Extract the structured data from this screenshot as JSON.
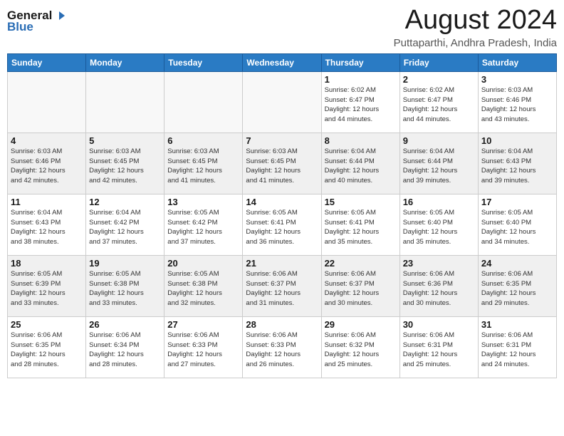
{
  "header": {
    "logo_general": "General",
    "logo_blue": "Blue",
    "main_title": "August 2024",
    "subtitle": "Puttaparthi, Andhra Pradesh, India"
  },
  "calendar": {
    "headers": [
      "Sunday",
      "Monday",
      "Tuesday",
      "Wednesday",
      "Thursday",
      "Friday",
      "Saturday"
    ],
    "weeks": [
      [
        {
          "day": "",
          "info": ""
        },
        {
          "day": "",
          "info": ""
        },
        {
          "day": "",
          "info": ""
        },
        {
          "day": "",
          "info": ""
        },
        {
          "day": "1",
          "info": "Sunrise: 6:02 AM\nSunset: 6:47 PM\nDaylight: 12 hours\nand 44 minutes."
        },
        {
          "day": "2",
          "info": "Sunrise: 6:02 AM\nSunset: 6:47 PM\nDaylight: 12 hours\nand 44 minutes."
        },
        {
          "day": "3",
          "info": "Sunrise: 6:03 AM\nSunset: 6:46 PM\nDaylight: 12 hours\nand 43 minutes."
        }
      ],
      [
        {
          "day": "4",
          "info": "Sunrise: 6:03 AM\nSunset: 6:46 PM\nDaylight: 12 hours\nand 42 minutes."
        },
        {
          "day": "5",
          "info": "Sunrise: 6:03 AM\nSunset: 6:45 PM\nDaylight: 12 hours\nand 42 minutes."
        },
        {
          "day": "6",
          "info": "Sunrise: 6:03 AM\nSunset: 6:45 PM\nDaylight: 12 hours\nand 41 minutes."
        },
        {
          "day": "7",
          "info": "Sunrise: 6:03 AM\nSunset: 6:45 PM\nDaylight: 12 hours\nand 41 minutes."
        },
        {
          "day": "8",
          "info": "Sunrise: 6:04 AM\nSunset: 6:44 PM\nDaylight: 12 hours\nand 40 minutes."
        },
        {
          "day": "9",
          "info": "Sunrise: 6:04 AM\nSunset: 6:44 PM\nDaylight: 12 hours\nand 39 minutes."
        },
        {
          "day": "10",
          "info": "Sunrise: 6:04 AM\nSunset: 6:43 PM\nDaylight: 12 hours\nand 39 minutes."
        }
      ],
      [
        {
          "day": "11",
          "info": "Sunrise: 6:04 AM\nSunset: 6:43 PM\nDaylight: 12 hours\nand 38 minutes."
        },
        {
          "day": "12",
          "info": "Sunrise: 6:04 AM\nSunset: 6:42 PM\nDaylight: 12 hours\nand 37 minutes."
        },
        {
          "day": "13",
          "info": "Sunrise: 6:05 AM\nSunset: 6:42 PM\nDaylight: 12 hours\nand 37 minutes."
        },
        {
          "day": "14",
          "info": "Sunrise: 6:05 AM\nSunset: 6:41 PM\nDaylight: 12 hours\nand 36 minutes."
        },
        {
          "day": "15",
          "info": "Sunrise: 6:05 AM\nSunset: 6:41 PM\nDaylight: 12 hours\nand 35 minutes."
        },
        {
          "day": "16",
          "info": "Sunrise: 6:05 AM\nSunset: 6:40 PM\nDaylight: 12 hours\nand 35 minutes."
        },
        {
          "day": "17",
          "info": "Sunrise: 6:05 AM\nSunset: 6:40 PM\nDaylight: 12 hours\nand 34 minutes."
        }
      ],
      [
        {
          "day": "18",
          "info": "Sunrise: 6:05 AM\nSunset: 6:39 PM\nDaylight: 12 hours\nand 33 minutes."
        },
        {
          "day": "19",
          "info": "Sunrise: 6:05 AM\nSunset: 6:38 PM\nDaylight: 12 hours\nand 33 minutes."
        },
        {
          "day": "20",
          "info": "Sunrise: 6:05 AM\nSunset: 6:38 PM\nDaylight: 12 hours\nand 32 minutes."
        },
        {
          "day": "21",
          "info": "Sunrise: 6:06 AM\nSunset: 6:37 PM\nDaylight: 12 hours\nand 31 minutes."
        },
        {
          "day": "22",
          "info": "Sunrise: 6:06 AM\nSunset: 6:37 PM\nDaylight: 12 hours\nand 30 minutes."
        },
        {
          "day": "23",
          "info": "Sunrise: 6:06 AM\nSunset: 6:36 PM\nDaylight: 12 hours\nand 30 minutes."
        },
        {
          "day": "24",
          "info": "Sunrise: 6:06 AM\nSunset: 6:35 PM\nDaylight: 12 hours\nand 29 minutes."
        }
      ],
      [
        {
          "day": "25",
          "info": "Sunrise: 6:06 AM\nSunset: 6:35 PM\nDaylight: 12 hours\nand 28 minutes."
        },
        {
          "day": "26",
          "info": "Sunrise: 6:06 AM\nSunset: 6:34 PM\nDaylight: 12 hours\nand 28 minutes."
        },
        {
          "day": "27",
          "info": "Sunrise: 6:06 AM\nSunset: 6:33 PM\nDaylight: 12 hours\nand 27 minutes."
        },
        {
          "day": "28",
          "info": "Sunrise: 6:06 AM\nSunset: 6:33 PM\nDaylight: 12 hours\nand 26 minutes."
        },
        {
          "day": "29",
          "info": "Sunrise: 6:06 AM\nSunset: 6:32 PM\nDaylight: 12 hours\nand 25 minutes."
        },
        {
          "day": "30",
          "info": "Sunrise: 6:06 AM\nSunset: 6:31 PM\nDaylight: 12 hours\nand 25 minutes."
        },
        {
          "day": "31",
          "info": "Sunrise: 6:06 AM\nSunset: 6:31 PM\nDaylight: 12 hours\nand 24 minutes."
        }
      ]
    ]
  }
}
